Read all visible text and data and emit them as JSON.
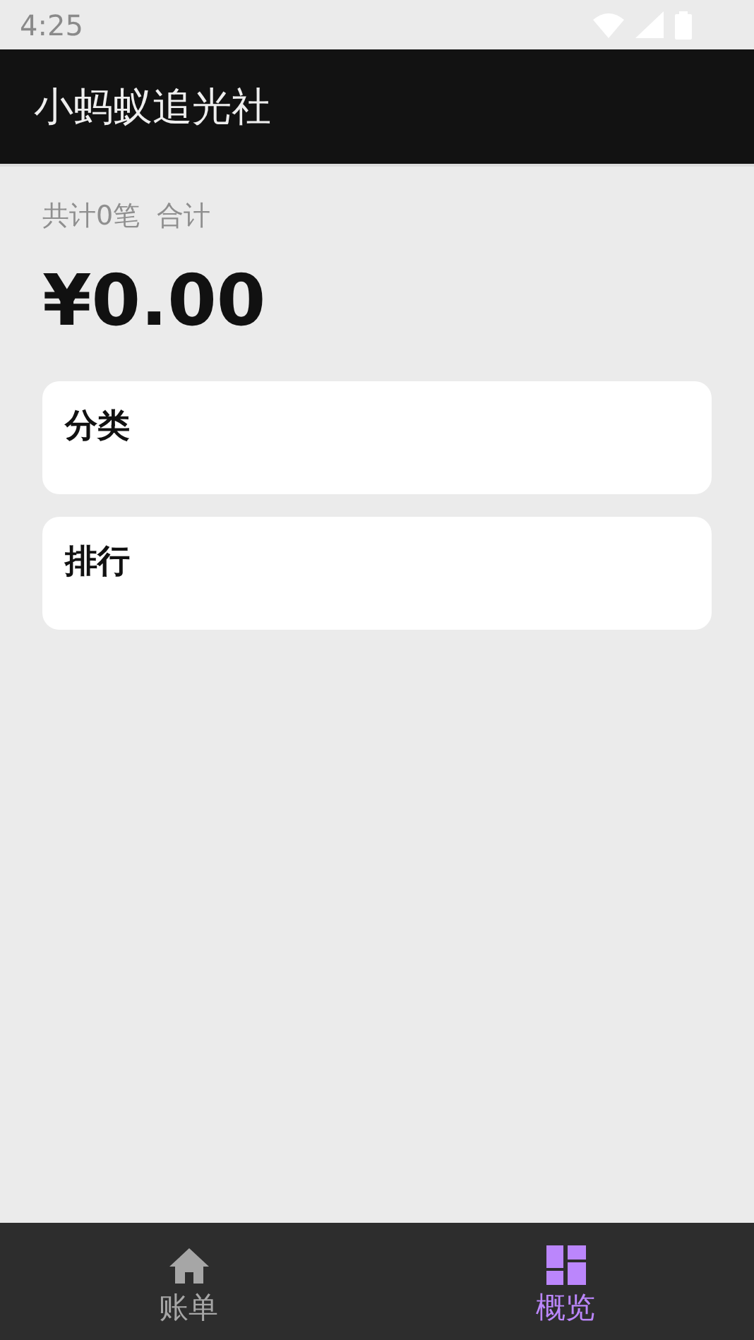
{
  "status_bar": {
    "time": "4:25"
  },
  "app_bar": {
    "title": "小蚂蚁追光社"
  },
  "summary": {
    "count_text": "共计0笔",
    "total_label": "合计",
    "amount": "¥0.00"
  },
  "cards": [
    {
      "title": "分类"
    },
    {
      "title": "排行"
    }
  ],
  "bottom_nav": [
    {
      "label": "账单",
      "kind": "home",
      "selected": false
    },
    {
      "label": "概览",
      "kind": "dashboard",
      "selected": true
    }
  ]
}
